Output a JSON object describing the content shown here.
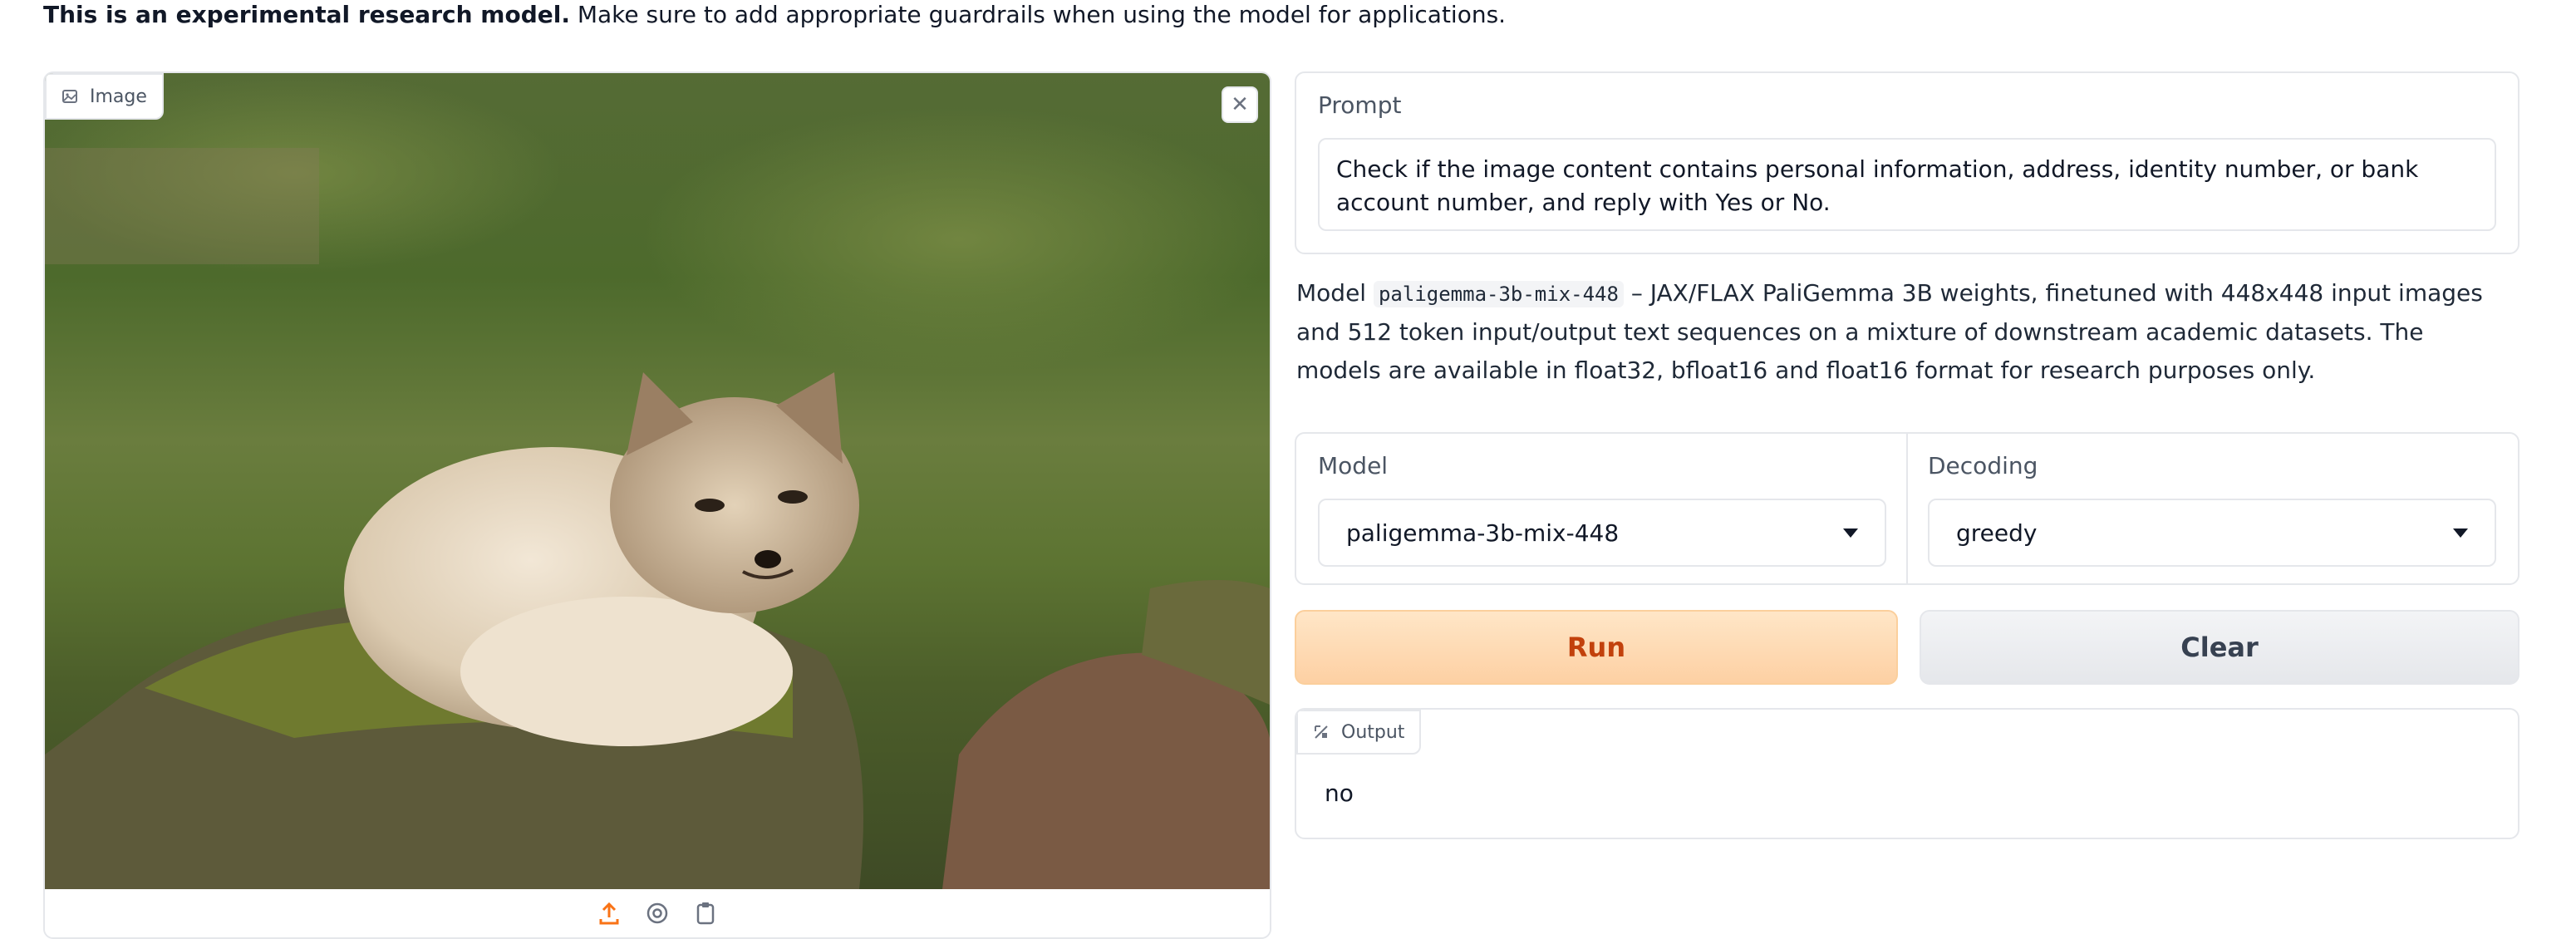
{
  "notice": {
    "bold": "This is an experimental research model.",
    "rest": " Make sure to add appropriate guardrails when using the model for applications."
  },
  "image_panel": {
    "label": "Image",
    "close_icon": "close-icon",
    "toolbar_icons": [
      "upload-icon",
      "webcam-icon",
      "clipboard-icon"
    ],
    "accent": "#f97316"
  },
  "prompt": {
    "label": "Prompt",
    "value": "Check if the image content contains personal information, address, identity number, or bank account number, and reply with Yes or No."
  },
  "model_info": {
    "prefix": "Model ",
    "code": "paligemma-3b-mix-448",
    "description": " – JAX/FLAX PaliGemma 3B weights, finetuned with 448x448 input images and 512 token input/output text sequences on a mixture of downstream academic datasets. The models are available in float32, bfloat16 and float16 format for research purposes only."
  },
  "settings": {
    "model_label": "Model",
    "model_value": "paligemma-3b-mix-448",
    "decoding_label": "Decoding",
    "decoding_value": "greedy"
  },
  "actions": {
    "run_label": "Run",
    "clear_label": "Clear"
  },
  "output": {
    "label": "Output",
    "value": "no"
  },
  "colors": {
    "run_text": "#c2410c",
    "run_bg": "#fdd0a3",
    "border": "#e5e7eb"
  }
}
